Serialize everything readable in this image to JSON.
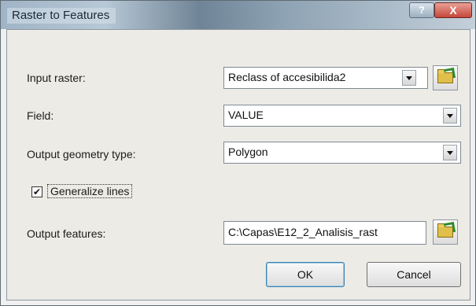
{
  "window": {
    "title": "Raster to Features",
    "help_glyph": "?",
    "close_glyph": "X"
  },
  "form": {
    "input_raster": {
      "label": "Input raster:",
      "value": "Reclass of accesibilida2",
      "browse_icon": "folder-open-icon"
    },
    "field": {
      "label": "Field:",
      "value": "VALUE"
    },
    "geometry": {
      "label": "Output geometry type:",
      "value": "Polygon"
    },
    "generalize": {
      "label": "Generalize lines",
      "checked": true,
      "check_glyph": "✔"
    },
    "output_features": {
      "label": "Output features:",
      "value": "C:\\Capas\\E12_2_Analisis_rast",
      "browse_icon": "folder-open-icon"
    }
  },
  "buttons": {
    "ok": "OK",
    "cancel": "Cancel"
  }
}
